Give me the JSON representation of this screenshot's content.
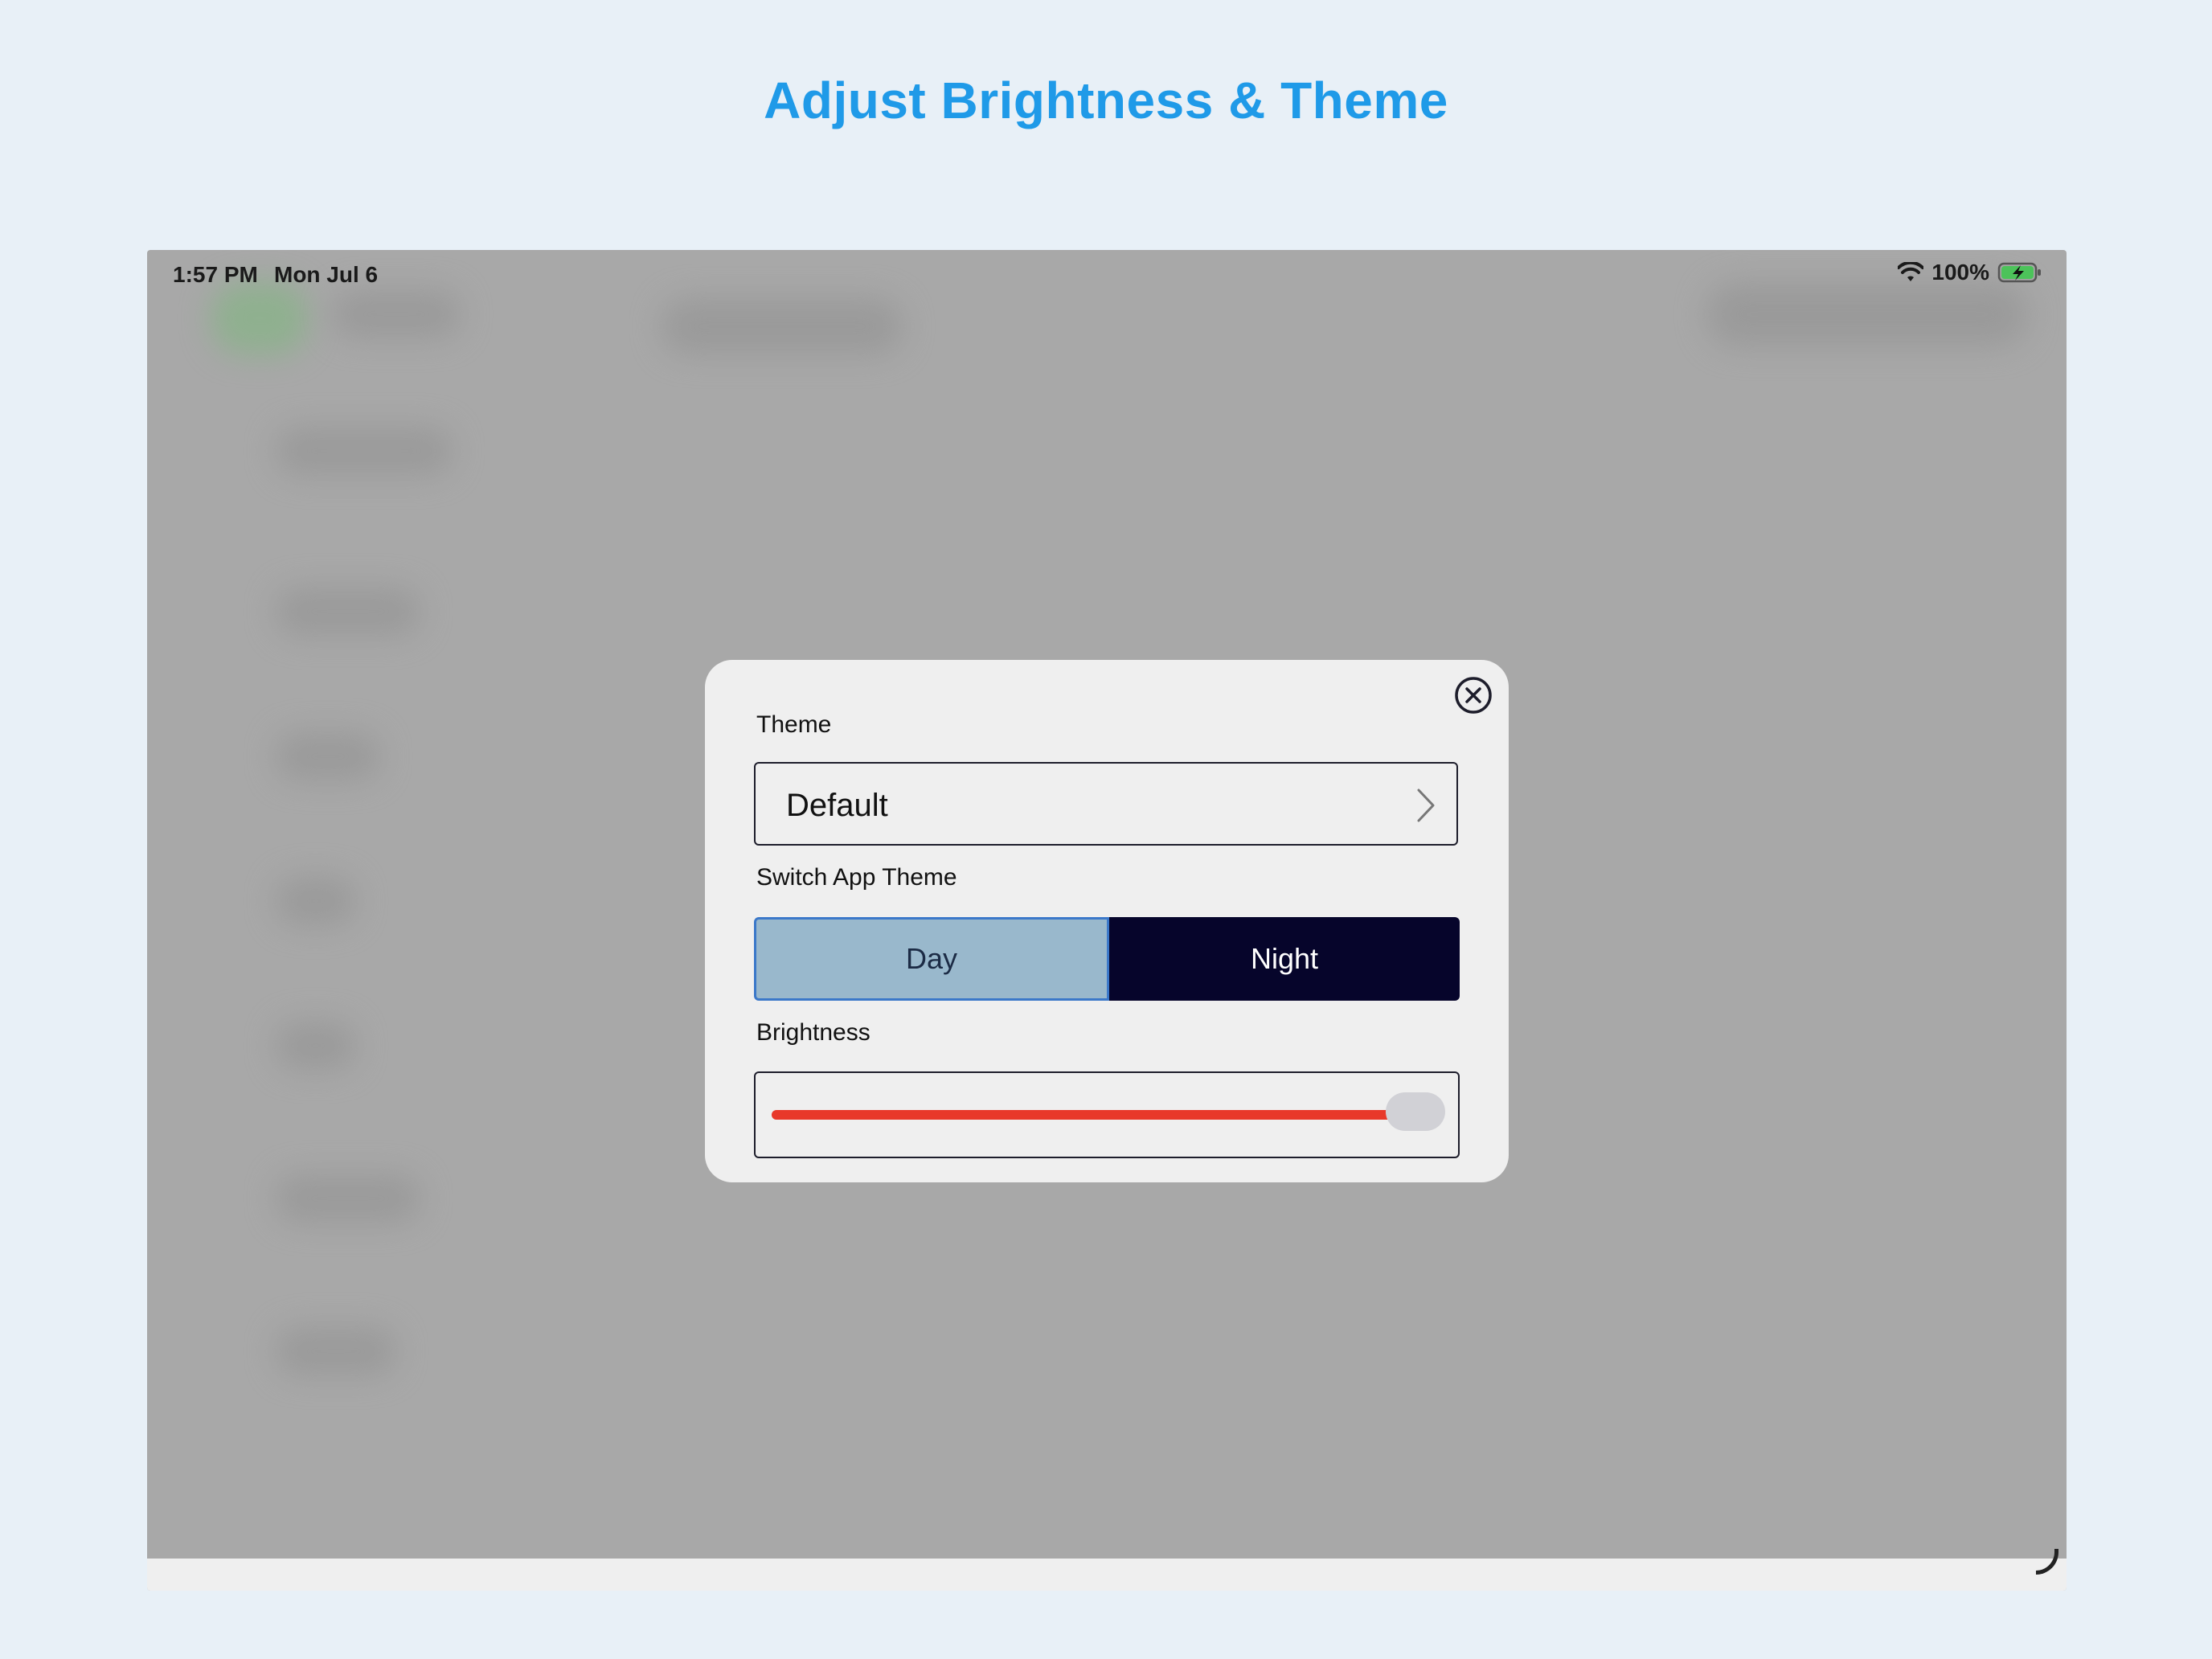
{
  "header": {
    "title": "Adjust Brightness & Theme"
  },
  "statusbar": {
    "time": "1:57 PM",
    "date": "Mon Jul 6",
    "battery_percent": "100%",
    "wifi_icon": "wifi-icon",
    "battery_icon": "battery-charging-icon"
  },
  "modal": {
    "close_icon": "close-circle-icon",
    "theme": {
      "label": "Theme",
      "value": "Default",
      "chevron_icon": "chevron-right-icon"
    },
    "switch_theme": {
      "label": "Switch App Theme",
      "options": [
        "Day",
        "Night"
      ],
      "selected": "Day"
    },
    "brightness": {
      "label": "Brightness",
      "value_fraction": 1.0,
      "fill_color": "#e8382a"
    }
  },
  "colors": {
    "title": "#1f9ae8",
    "overlay": "#a8a8a8",
    "day_selected_bg": "#99b8cc",
    "night_bg": "#06052b"
  }
}
